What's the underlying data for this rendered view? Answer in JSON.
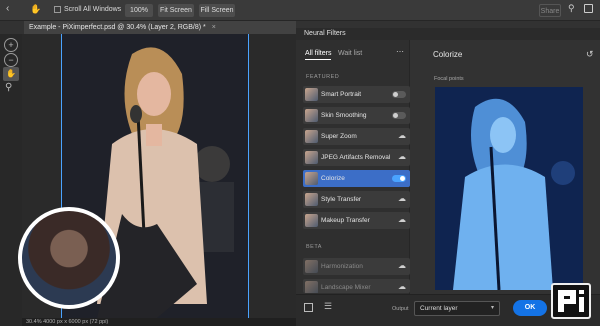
{
  "toolbar": {
    "scroll_all_windows": "Scroll All Windows",
    "zoom": "100%",
    "fit_screen": "Fit Screen",
    "fill_screen": "Fill Screen",
    "share": "Share"
  },
  "document": {
    "tab_title": "Example - PiXimperfect.psd @ 30.4% (Layer 2, RGB/8) *",
    "status": "30.4%   4000 px x 6000 px (72 ppi)"
  },
  "neural_filters": {
    "panel_title": "Neural Filters",
    "tabs": [
      "All filters",
      "Wait list"
    ],
    "featured_label": "FEATURED",
    "beta_label": "BETA",
    "filters": [
      {
        "label": "Smart Portrait",
        "control": "toggle",
        "on": false
      },
      {
        "label": "Skin Smoothing",
        "control": "toggle",
        "on": false
      },
      {
        "label": "Super Zoom",
        "control": "download"
      },
      {
        "label": "JPEG Artifacts Removal",
        "control": "download"
      },
      {
        "label": "Colorize",
        "control": "toggle",
        "on": true,
        "selected": true
      },
      {
        "label": "Style Transfer",
        "control": "download"
      },
      {
        "label": "Makeup Transfer",
        "control": "download"
      }
    ],
    "beta_filters": [
      {
        "label": "Harmonization",
        "control": "download"
      },
      {
        "label": "Landscape Mixer",
        "control": "download"
      }
    ],
    "selected_title": "Colorize",
    "focal_points_label": "Focal points",
    "output_label": "Output",
    "output_value": "Current layer",
    "ok_label": "OK"
  },
  "colors": {
    "accent": "#1473e6",
    "selected_row": "#3c6ec7",
    "selection_border": "#4aa3ff"
  }
}
